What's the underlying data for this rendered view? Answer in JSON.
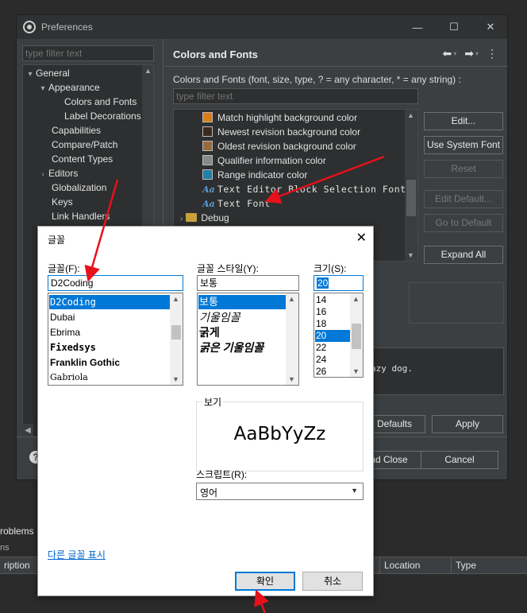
{
  "pref_window": {
    "title": "Preferences",
    "filter_placeholder": "type filter text",
    "tree": [
      {
        "label": "General",
        "indent": 0,
        "arrow": "▾"
      },
      {
        "label": "Appearance",
        "indent": 1,
        "arrow": "▾"
      },
      {
        "label": "Colors and Fonts",
        "indent": 2,
        "arrow": ""
      },
      {
        "label": "Label Decorations",
        "indent": 2,
        "arrow": ""
      },
      {
        "label": "Capabilities",
        "indent": 1,
        "arrow": ""
      },
      {
        "label": "Compare/Patch",
        "indent": 1,
        "arrow": ""
      },
      {
        "label": "Content Types",
        "indent": 1,
        "arrow": ""
      },
      {
        "label": "Editors",
        "indent": 1,
        "arrow": "›"
      },
      {
        "label": "Globalization",
        "indent": 1,
        "arrow": ""
      },
      {
        "label": "Keys",
        "indent": 1,
        "arrow": ""
      },
      {
        "label": "Link Handlers",
        "indent": 1,
        "arrow": ""
      }
    ],
    "page_title": "Colors and Fonts",
    "description": "Colors and Fonts (font, size, type, ? = any character, * = any string) :",
    "list_filter_placeholder": "type filter text",
    "color_items": [
      {
        "label": "Match highlight background color",
        "color": "#e07b1a",
        "kind": "swatch"
      },
      {
        "label": "Newest revision background color",
        "color": "#3a2a1c",
        "kind": "swatch"
      },
      {
        "label": "Oldest revision background color",
        "color": "#9a6b3a",
        "kind": "swatch"
      },
      {
        "label": "Qualifier information color",
        "color": "#8a8a8a",
        "kind": "swatch"
      },
      {
        "label": "Range indicator color",
        "color": "#1f7fa8",
        "kind": "swatch"
      },
      {
        "label": "Text Editor Block Selection Font",
        "kind": "font"
      },
      {
        "label": "Text Font",
        "kind": "font"
      },
      {
        "label": "Debug",
        "kind": "folder"
      }
    ],
    "buttons": {
      "edit": "Edit...",
      "use_system_font": "Use System Font",
      "reset": "Reset",
      "edit_default": "Edit Default...",
      "go_to_default": "Go to Default",
      "expand_all": "Expand All",
      "restore_defaults": "re Defaults",
      "apply": "Apply",
      "apply_close": "nd Close",
      "cancel": "Cancel"
    },
    "preview_text": "azy dog."
  },
  "bottom_panel": {
    "problems_tab": "roblems",
    "items_label": "ns",
    "columns": [
      "ription",
      "Location",
      "Type"
    ]
  },
  "font_dialog": {
    "title": "글꼴",
    "font_label": "글꼴(F):",
    "font_value": "D2Coding",
    "fonts": [
      "D2Coding",
      "Dubai",
      "Ebrima",
      "Fixedsys",
      "Franklin Gothic",
      "Gabriola"
    ],
    "style_label": "글꼴 스타일(Y):",
    "style_value": "보통",
    "styles": [
      "보통",
      "기울임꼴",
      "굵게",
      "굵은 기울임꼴"
    ],
    "size_label": "크기(S):",
    "size_value": "20",
    "sizes": [
      "14",
      "16",
      "18",
      "20",
      "22",
      "24",
      "26"
    ],
    "sample_label": "보기",
    "sample_text": "AaBbYyZz",
    "script_label": "스크립트(R):",
    "script_value": "영어",
    "more_fonts_link": "다른 글꼴 표시",
    "ok": "확인",
    "cancel": "취소"
  },
  "accent_color": "#0078d7",
  "annotation_color": "#e8101a"
}
